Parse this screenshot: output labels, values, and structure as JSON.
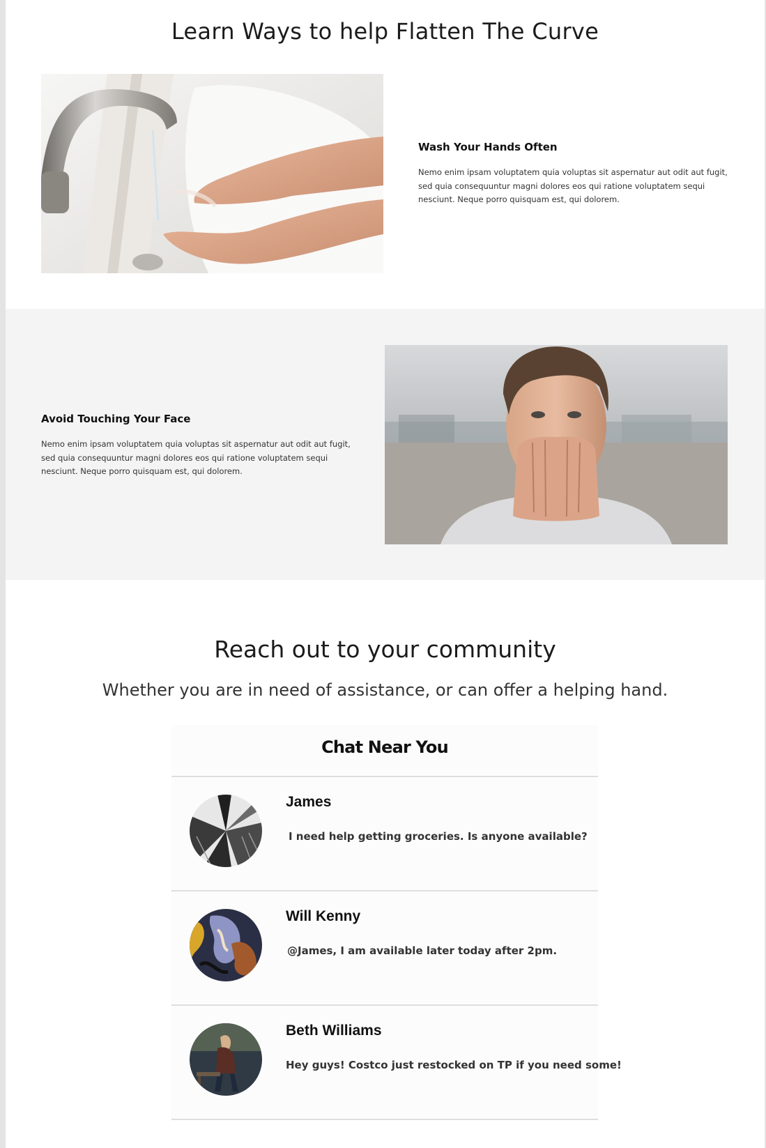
{
  "section1": {
    "title": "Learn Ways to help Flatten The Curve"
  },
  "features": [
    {
      "title": "Wash Your Hands Often",
      "text": "Nemo enim ipsam voluptatem quia voluptas sit aspernatur aut odit aut fugit, sed quia consequuntur magni dolores eos qui ratione voluptatem sequi nesciunt. Neque porro quisquam est, qui dolorem.",
      "image": "hand-washing-photo"
    },
    {
      "title": "Avoid Touching Your Face",
      "text": "Nemo enim ipsam voluptatem quia voluptas sit aspernatur aut odit aut fugit, sed quia consequuntur magni dolores eos qui ratione voluptatem sequi nesciunt. Neque porro quisquam est, qui dolorem.",
      "image": "man-touching-face-photo"
    }
  ],
  "community": {
    "title": "Reach out to your community",
    "subtitle": "Whether you are in need of assistance, or can offer a helping hand."
  },
  "chat": {
    "title": "Chat Near You",
    "messages": [
      {
        "name": "James",
        "text": "I need help getting groceries. Is anyone available?",
        "avatar": "skyscrapers-avatar"
      },
      {
        "name": "Will Kenny",
        "text": "@James, I am available later today after 2pm.",
        "avatar": "abstract-paint-avatar"
      },
      {
        "name": "Beth Williams",
        "text": "Hey guys! Costco just restocked on TP if you need some!",
        "avatar": "person-on-bench-avatar"
      }
    ]
  },
  "colors": {
    "band": "#f4f4f4",
    "page_background": "#ffffff",
    "divider": "#dedede"
  }
}
